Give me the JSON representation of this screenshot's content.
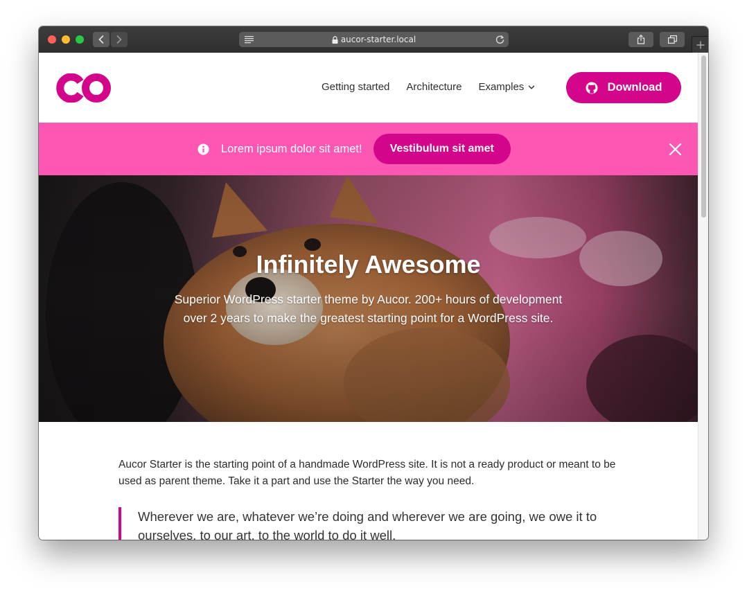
{
  "browser": {
    "url": "aucor-starter.local"
  },
  "colors": {
    "accent": "#d3058b",
    "notice_bg": "#fd57b4",
    "text": "#2b2b2b"
  },
  "header": {
    "logo_alt": "co",
    "menu": [
      {
        "label": "Getting started"
      },
      {
        "label": "Architecture"
      },
      {
        "label": "Examples"
      }
    ],
    "download_label": "Download"
  },
  "notice": {
    "text": "Lorem ipsum dolor sit amet!",
    "button_label": "Vestibulum sit amet"
  },
  "hero": {
    "title": "Infinitely Awesome",
    "lede": "Superior WordPress starter theme by Aucor. 200+ hours of development over 2 years to make the greatest starting point for a WordPress site."
  },
  "content": {
    "intro": "Aucor Starter is the starting point of a handmade WordPress site. It is not a ready product or meant to be used as parent theme. Take it a part and use the Starter the way you need.",
    "quote": "Wherever we are, whatever we’re doing and wherever we are going, we owe it to ourselves, to our art, to the world to do it well."
  },
  "icons": {
    "reader": "reader-mode-icon",
    "lock": "lock-icon",
    "reload": "reload-icon",
    "share": "share-icon",
    "tabs": "tabs-icon",
    "new_tab": "plus-icon",
    "github": "github-icon",
    "info": "info-icon",
    "close": "close-icon",
    "chevron": "chevron-down-icon"
  }
}
